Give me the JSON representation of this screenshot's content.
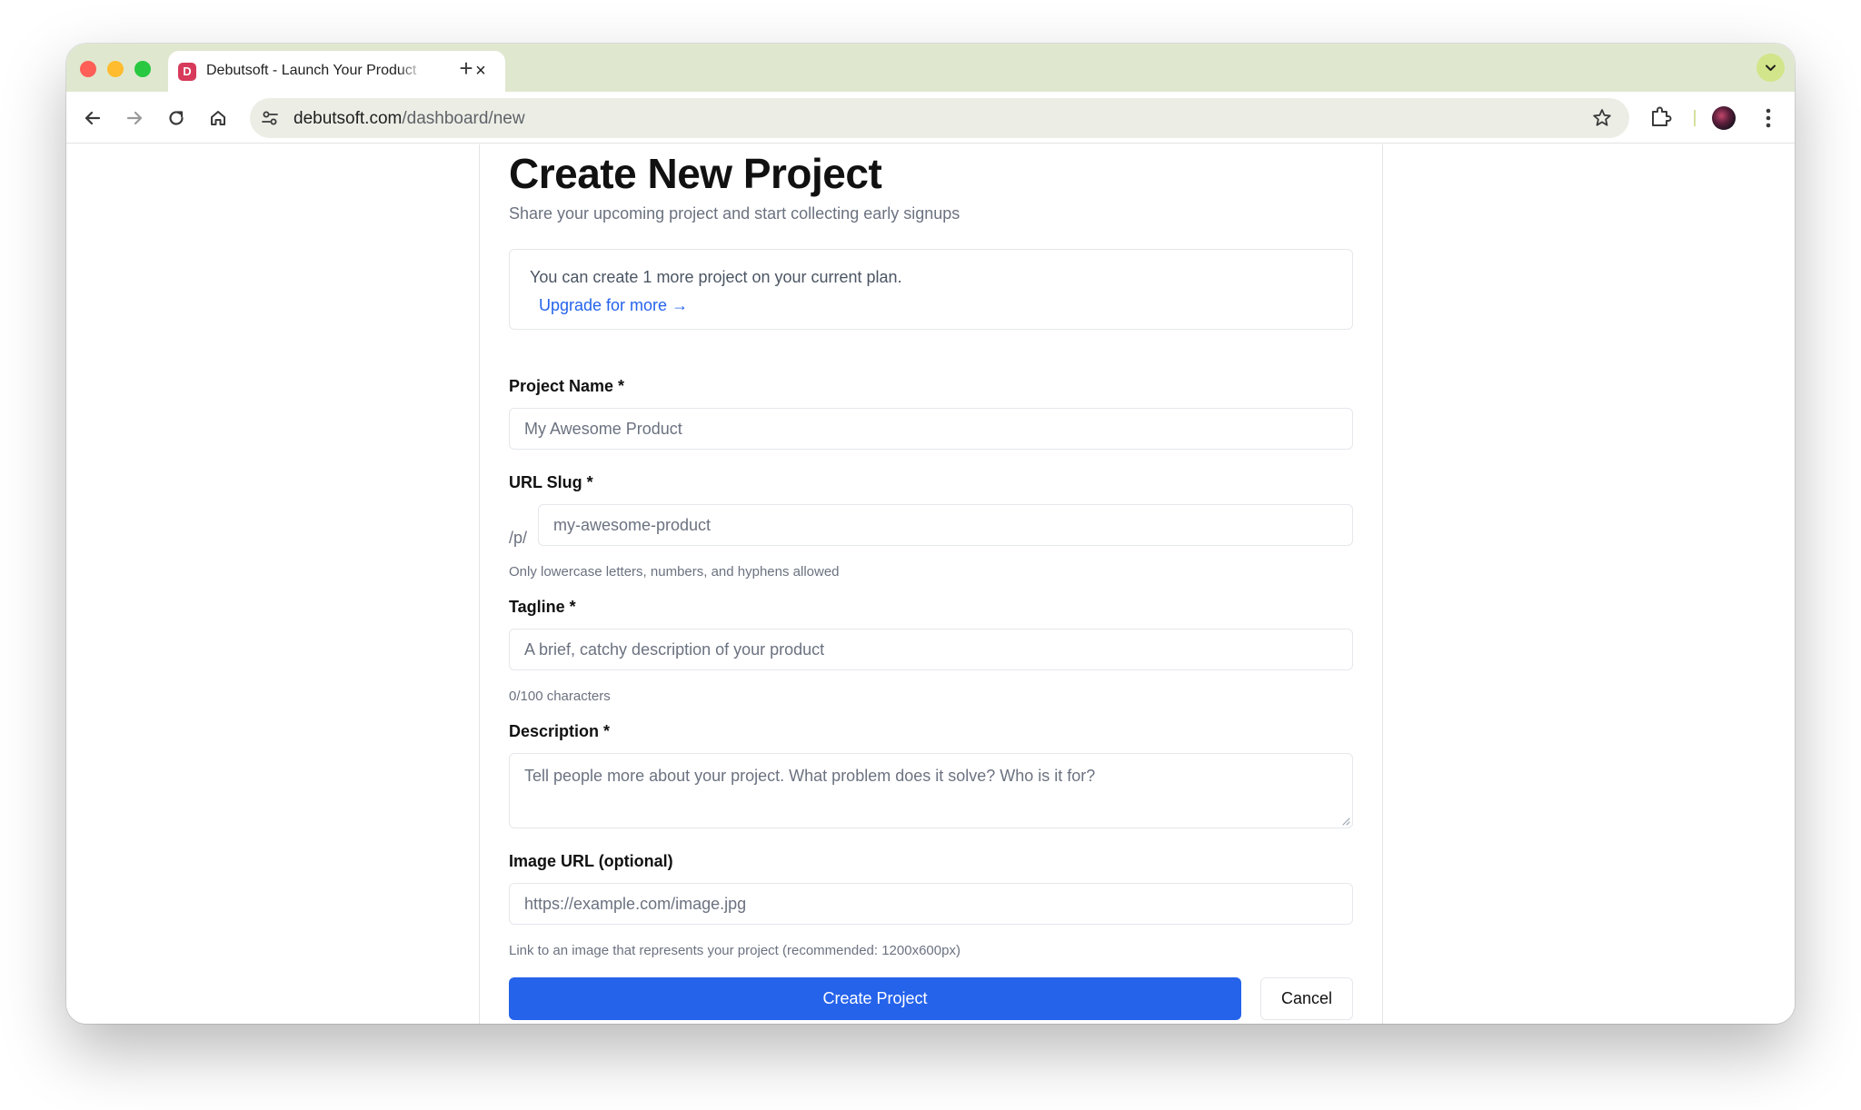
{
  "browser": {
    "tab": {
      "title": "Debutsoft - Launch Your Product",
      "favicon_letter": "D",
      "favicon_color": "#d73a5a"
    },
    "url": {
      "host": "debutsoft.com",
      "path": "/dashboard/new"
    },
    "icons": {
      "back": "back-arrow-icon",
      "forward": "forward-arrow-icon",
      "reload": "reload-icon",
      "home": "home-icon",
      "site_info": "tune-icon",
      "bookmark": "star-icon",
      "extensions": "puzzle-icon",
      "menu": "kebab-menu-icon",
      "tab_search": "chevron-down-icon"
    }
  },
  "page": {
    "title": "Create New Project",
    "subtitle": "Share your upcoming project and start collecting early signups",
    "plan_notice": {
      "text": "You can create 1 more project on your current plan.",
      "link": "Upgrade for more →"
    },
    "form": {
      "project_name": {
        "label": "Project Name *",
        "placeholder": "My Awesome Product"
      },
      "url_slug": {
        "label": "URL Slug *",
        "prefix": "/p/",
        "placeholder": "my-awesome-product",
        "help": "Only lowercase letters, numbers, and hyphens allowed"
      },
      "tagline": {
        "label": "Tagline *",
        "placeholder": "A brief, catchy description of your product",
        "counter": "0/100 characters"
      },
      "description": {
        "label": "Description *",
        "placeholder": "Tell people more about your project. What problem does it solve? Who is it for?"
      },
      "image_url": {
        "label": "Image URL (optional)",
        "placeholder": "https://example.com/image.jpg",
        "help": "Link to an image that represents your project (recommended: 1200x600px)"
      }
    },
    "actions": {
      "submit": "Create Project",
      "cancel": "Cancel"
    },
    "colors": {
      "primary": "#2563eb",
      "link": "#2563eb",
      "tabstrip": "#dfe8cf"
    }
  }
}
